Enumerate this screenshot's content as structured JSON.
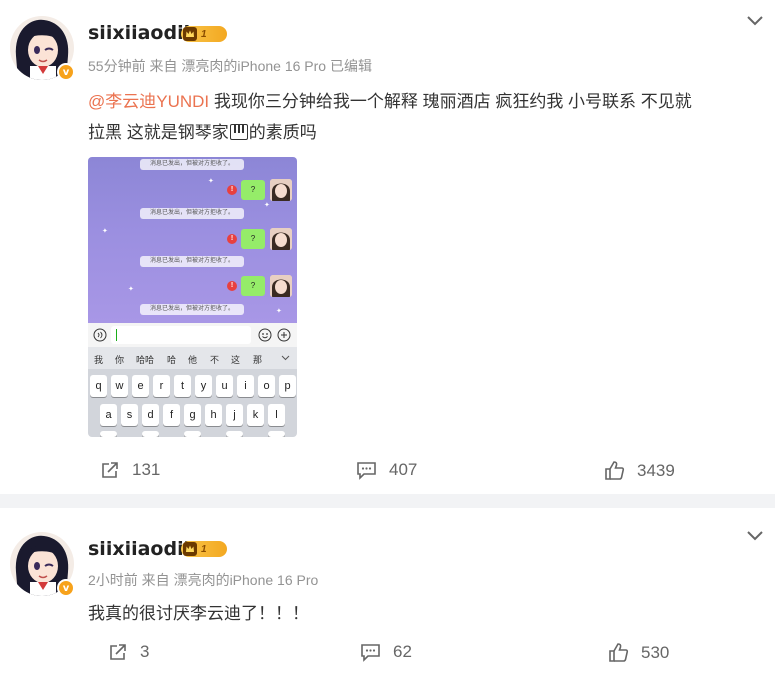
{
  "posts": [
    {
      "username": "siixiiaodii",
      "level": "1",
      "verified_glyph": "v",
      "meta": "55分钟前  来自 漂亮肉的iPhone 16 Pro 已编辑",
      "mention": "@李云迪YUNDI",
      "text_line1_rest": " 我现你三分钟给我一个解释 瑰丽酒店 疯狂约我 小号联系 不见就",
      "text_line2_before_icon": "拉黑 这就是钢琴家",
      "text_line2_after_icon": "的素质吗",
      "icon_in_text": "piano-emoji-icon",
      "actions": {
        "repost": "131",
        "comment": "407",
        "like": "3439"
      }
    },
    {
      "username": "siixiiaodii",
      "level": "1",
      "verified_glyph": "v",
      "meta": "2小时前  来自 漂亮肉的iPhone 16 Pro",
      "text": "我真的很讨厌李云迪了！！！",
      "actions": {
        "repost": "3",
        "comment": "62",
        "like": "530"
      }
    }
  ],
  "screenshot": {
    "system_message": "消息已发出，但被对方拒收了。",
    "bubble_text": "?",
    "error_glyph": "!",
    "candidates": [
      "我",
      "你",
      "哈哈",
      "哈",
      "他",
      "不",
      "这",
      "那"
    ],
    "keyboard_row1": [
      "q",
      "w",
      "e",
      "r",
      "t",
      "y",
      "u",
      "i",
      "o",
      "p"
    ],
    "keyboard_row2": [
      "a",
      "s",
      "d",
      "f",
      "g",
      "h",
      "j",
      "k",
      "l"
    ]
  },
  "colors": {
    "mention": "#eb7350",
    "meta_gray": "#939393",
    "level_badge": "#f3a821",
    "verified_badge": "#f7a21b"
  }
}
